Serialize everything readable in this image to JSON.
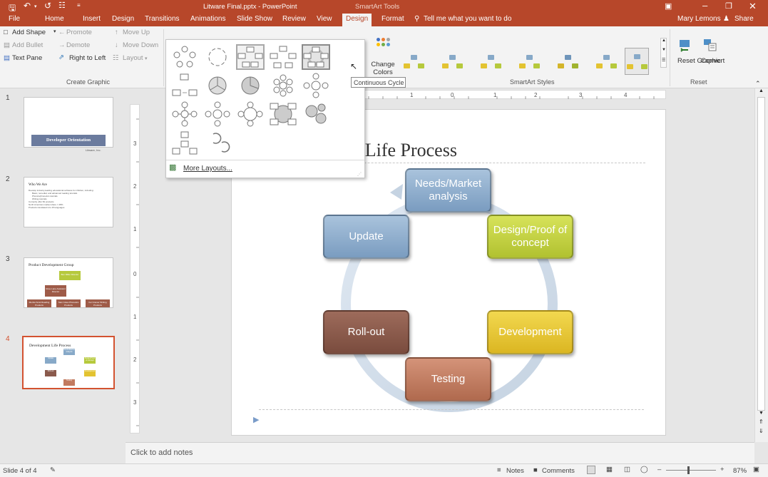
{
  "titlebar": {
    "document_title": "Litware Final.pptx - PowerPoint",
    "context_label": "SmartArt Tools",
    "quick_access_icons": [
      "save-icon",
      "undo-icon",
      "redo-icon",
      "present-icon",
      "customize-icon"
    ]
  },
  "tabs": [
    {
      "label": "File"
    },
    {
      "label": "Home"
    },
    {
      "label": "Insert"
    },
    {
      "label": "Design"
    },
    {
      "label": "Transitions"
    },
    {
      "label": "Animations"
    },
    {
      "label": "Slide Show"
    },
    {
      "label": "Review"
    },
    {
      "label": "View"
    },
    {
      "label": "Design"
    },
    {
      "label": "Format"
    }
  ],
  "tell_me": "Tell me what you want to do",
  "user": "Mary Lemons",
  "share": "Share",
  "ribbon": {
    "create_graphic": {
      "add_shape": "Add Shape",
      "add_bullet": "Add Bullet",
      "text_pane": "Text Pane",
      "promote": "Promote",
      "demote": "Demote",
      "right_to_left": "Right to Left",
      "move_up": "Move Up",
      "move_down": "Move Down",
      "layout": "Layout",
      "group_label": "Create Graphic"
    },
    "change_colors": "Change Colors",
    "smartart_styles_label": "SmartArt Styles",
    "reset_graphic": "Reset Graphic",
    "convert": "Convert",
    "reset_label": "Reset"
  },
  "layout_gallery": {
    "more_layouts": "More Layouts...",
    "tooltip": "Continuous Cycle"
  },
  "slides": [
    {
      "number": "1",
      "title": "Developer Orientation",
      "subtitle": "Litware, Inc."
    },
    {
      "number": "2",
      "title": "Who We Are",
      "bullets": [
        "Develop industry-leading educational software for children, including:",
        "Basic, remedial, and advanced reading tutorials",
        "Phonics/phonetics tutorials",
        "Writing tutorials",
        "Currently offer 82 products",
        "North American market share = 48%",
        "Products translated into 15 languages"
      ]
    },
    {
      "number": "3",
      "title": "Product Development Group",
      "boxes": [
        "Ben Miller Director",
        "Rose Lane Assistant Director",
        "Mentia Scott Reading Products",
        "Sian Coles Phonetics Products",
        "Fei Cramer Writing Products"
      ]
    },
    {
      "number": "4",
      "title": "Development Life Process",
      "boxes": [
        "Needs/Market analysis",
        "Design/Proof of concept",
        "Development",
        "Testing",
        "Roll-out",
        "Update"
      ]
    }
  ],
  "slide": {
    "title_visible": "nt Life Process",
    "cycle": [
      {
        "label": "Needs/Market analysis",
        "color": "#87a9c8"
      },
      {
        "label": "Design/Proof of concept",
        "color": "#b6c93c"
      },
      {
        "label": "Development",
        "color": "#e3c331"
      },
      {
        "label": "Testing",
        "color": "#c27a5f"
      },
      {
        "label": "Roll-out",
        "color": "#8a5a4c"
      },
      {
        "label": "Update",
        "color": "#87a9c8"
      }
    ]
  },
  "notes_placeholder": "Click to add notes",
  "status": {
    "slide_of": "Slide 4 of 4",
    "notes": "Notes",
    "comments": "Comments",
    "zoom": "87%"
  },
  "colors": {
    "brand": "#b7472a",
    "selection": "#d35230"
  }
}
